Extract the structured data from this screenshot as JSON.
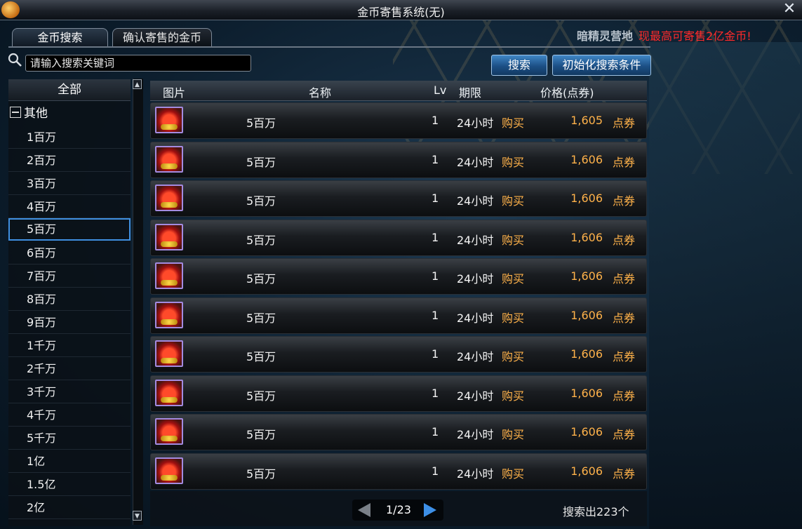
{
  "window": {
    "title": "金币寄售系统(无)",
    "close_glyph": "✕"
  },
  "tabs": [
    {
      "label": "金币搜索",
      "active": true
    },
    {
      "label": "确认寄售的金币",
      "active": false
    }
  ],
  "promo": {
    "place": "暗精灵营地",
    "text": "现最高可寄售2亿金币!"
  },
  "search": {
    "placeholder": "请输入搜索关键词",
    "value": "",
    "search_label": "搜索",
    "reset_label": "初始化搜索条件"
  },
  "categories": {
    "all_label": "全部",
    "group_label": "其他",
    "items": [
      "1百万",
      "2百万",
      "3百万",
      "4百万",
      "5百万",
      "6百万",
      "7百万",
      "8百万",
      "9百万",
      "1千万",
      "2千万",
      "3千万",
      "4千万",
      "5千万",
      "1亿",
      "1.5亿",
      "2亿"
    ],
    "selected": "5百万"
  },
  "table": {
    "headers": {
      "image": "图片",
      "name": "名称",
      "lv": "Lv",
      "duration": "期限",
      "price": "价格(点券)"
    },
    "rows": [
      {
        "name": "5百万",
        "lv": "1",
        "duration": "24小时",
        "action": "购买",
        "price": "1,605",
        "unit": "点券"
      },
      {
        "name": "5百万",
        "lv": "1",
        "duration": "24小时",
        "action": "购买",
        "price": "1,606",
        "unit": "点券"
      },
      {
        "name": "5百万",
        "lv": "1",
        "duration": "24小时",
        "action": "购买",
        "price": "1,606",
        "unit": "点券"
      },
      {
        "name": "5百万",
        "lv": "1",
        "duration": "24小时",
        "action": "购买",
        "price": "1,606",
        "unit": "点券"
      },
      {
        "name": "5百万",
        "lv": "1",
        "duration": "24小时",
        "action": "购买",
        "price": "1,606",
        "unit": "点券"
      },
      {
        "name": "5百万",
        "lv": "1",
        "duration": "24小时",
        "action": "购买",
        "price": "1,606",
        "unit": "点券"
      },
      {
        "name": "5百万",
        "lv": "1",
        "duration": "24小时",
        "action": "购买",
        "price": "1,606",
        "unit": "点券"
      },
      {
        "name": "5百万",
        "lv": "1",
        "duration": "24小时",
        "action": "购买",
        "price": "1,606",
        "unit": "点券"
      },
      {
        "name": "5百万",
        "lv": "1",
        "duration": "24小时",
        "action": "购买",
        "price": "1,606",
        "unit": "点券"
      },
      {
        "name": "5百万",
        "lv": "1",
        "duration": "24小时",
        "action": "购买",
        "price": "1,606",
        "unit": "点券"
      }
    ]
  },
  "pagination": {
    "text": "1/23",
    "result_count": "搜索出223个"
  },
  "icons": {
    "window_logo": "game-logo-icon",
    "search": "magnifier-icon",
    "item": "gold-pouch-icon",
    "prev": "left-arrow-icon",
    "next": "right-arrow-icon"
  }
}
